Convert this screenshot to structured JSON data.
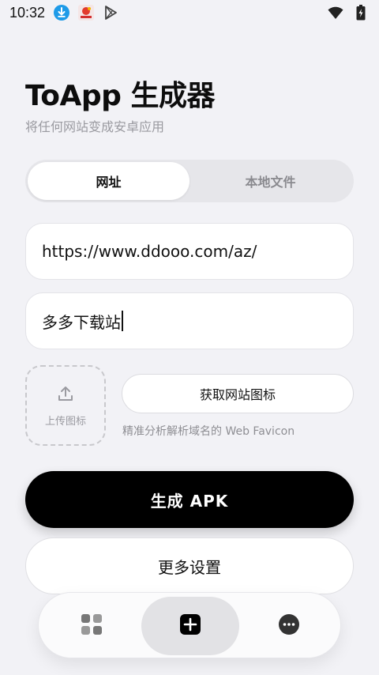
{
  "status_bar": {
    "time": "10:32",
    "left_icons": [
      "download-icon",
      "app-notification-icon",
      "play-store-icon"
    ],
    "right_icons": [
      "wifi-icon",
      "battery-charging-icon"
    ]
  },
  "header": {
    "title": "ToApp 生成器",
    "subtitle": "将任何网站变成安卓应用"
  },
  "tabs": [
    {
      "label": "网址",
      "active": true
    },
    {
      "label": "本地文件",
      "active": false
    }
  ],
  "form": {
    "url_value": "https://www.ddooo.com/az/",
    "name_value": "多多下载站",
    "upload_label": "上传图标",
    "fetch_label": "获取网站图标",
    "fetch_hint": "精准分析解析域名的 Web Favicon"
  },
  "actions": {
    "generate_label": "生成 APK",
    "more_settings_label": "更多设置"
  },
  "bottom_nav": {
    "items": [
      "apps-grid-icon",
      "add-square-icon",
      "more-circle-icon"
    ],
    "active": "add-square-icon"
  },
  "colors": {
    "background": "#f2f2f6",
    "primary": "#000000",
    "accent_download": "#1e9be8"
  }
}
